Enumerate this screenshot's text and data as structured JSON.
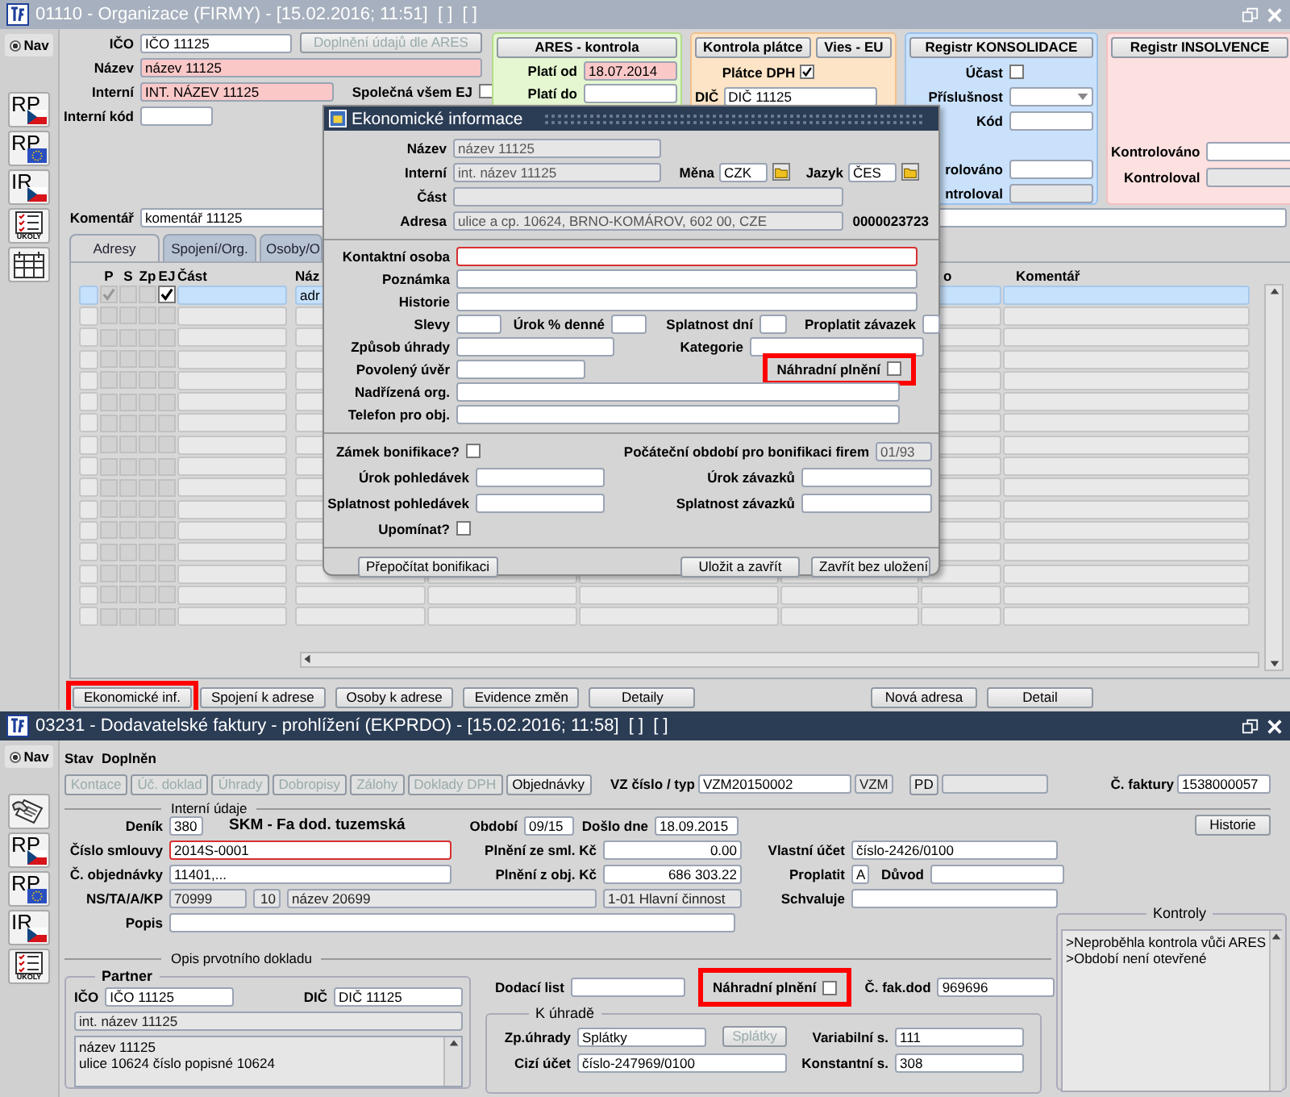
{
  "org_window": {
    "title": "01110 - Organizace (FIRMY) - [15.02.2016; 11:51]  [ ]  [ ]",
    "active": false,
    "nav": {
      "label": "Nav",
      "selected": true
    },
    "tools": [
      {
        "kind": "flag-cz",
        "label": "RP"
      },
      {
        "kind": "flag-eu",
        "label": "RP"
      },
      {
        "kind": "flag-cz",
        "label": "IR"
      },
      {
        "kind": "tasks",
        "label": "ÚKOLY"
      },
      {
        "kind": "calendar"
      }
    ],
    "ico": {
      "label": "IČO",
      "value": "IČO 11125"
    },
    "ares_fill_button": {
      "label": "Doplnění údajů dle ARES",
      "disabled": true
    },
    "nazev": {
      "label": "Název",
      "value": "název 11125",
      "required": true
    },
    "interni": {
      "label": "Interní",
      "value": "INT. NÁZEV 11125",
      "required": true
    },
    "shared": {
      "label": "Společná všem EJ",
      "checked": false
    },
    "interni_kod": {
      "label": "Interní kód"
    },
    "ares_panel": {
      "button": "ARES - kontrola",
      "plati_od": {
        "label": "Platí od",
        "value": "18.07.2014",
        "required": true
      },
      "plati_do": {
        "label": "Platí do"
      }
    },
    "payer_panel": {
      "buttons": [
        "Kontrola plátce",
        "Vies - EU"
      ],
      "platce": {
        "label": "Plátce DPH",
        "checked": true
      },
      "dic": {
        "label": "DIČ",
        "value": "DIČ 11125"
      }
    },
    "consolidation_panel": {
      "button": "Registr KONSOLIDACE",
      "ucast": {
        "label": "Účast",
        "checked": false
      },
      "prislusnost": {
        "label": "Příslušnost"
      },
      "kod": {
        "label": "Kód"
      },
      "kontrolovano": {
        "label": "rolováno",
        "readonly": false
      },
      "kontroloval": {
        "label": "ntroloval",
        "readonly": true
      }
    },
    "insolvency_panel": {
      "button": "Registr INSOLVENCE",
      "kontrolovano": {
        "label": "Kontrolováno",
        "readonly": false
      },
      "kontroloval": {
        "label": "Kontroloval",
        "readonly": true
      }
    },
    "komentar": {
      "label": "Komentář",
      "value": "komentář 11125"
    },
    "tabs": [
      {
        "label": "Adresy",
        "selected": true
      },
      {
        "label": "Spojení/Org.",
        "selected": false
      },
      {
        "label": "Osoby/O",
        "selected": false
      }
    ],
    "table": {
      "columns": [
        "P",
        "S",
        "Zp",
        "EJ",
        "Část",
        "Náz",
        "o",
        "Komentář"
      ],
      "rows": [
        {
          "selected": true,
          "p": true,
          "s": false,
          "zp": false,
          "ej": true,
          "name": "adr"
        },
        {
          "selected": false,
          "p": false,
          "s": false,
          "zp": false,
          "ej": false
        },
        {
          "selected": false,
          "p": false,
          "s": false,
          "zp": false,
          "ej": false
        },
        {
          "selected": false,
          "p": false,
          "s": false,
          "zp": false,
          "ej": false
        },
        {
          "selected": false,
          "p": false,
          "s": false,
          "zp": false,
          "ej": false
        },
        {
          "selected": false,
          "p": false,
          "s": false,
          "zp": false,
          "ej": false
        },
        {
          "selected": false,
          "p": false,
          "s": false,
          "zp": false,
          "ej": false
        },
        {
          "selected": false,
          "p": false,
          "s": false,
          "zp": false,
          "ej": false
        },
        {
          "selected": false,
          "p": false,
          "s": false,
          "zp": false,
          "ej": false
        },
        {
          "selected": false,
          "p": false,
          "s": false,
          "zp": false,
          "ej": false
        },
        {
          "selected": false,
          "p": false,
          "s": false,
          "zp": false,
          "ej": false
        },
        {
          "selected": false,
          "p": false,
          "s": false,
          "zp": false,
          "ej": false
        },
        {
          "selected": false,
          "p": false,
          "s": false,
          "zp": false,
          "ej": false
        },
        {
          "selected": false,
          "p": false,
          "s": false,
          "zp": false,
          "ej": false
        },
        {
          "selected": false,
          "p": false,
          "s": false,
          "zp": false,
          "ej": false
        },
        {
          "selected": false,
          "p": false,
          "s": false,
          "zp": false,
          "ej": false
        }
      ]
    },
    "buttons": [
      {
        "label": "Ekonomické inf.",
        "highlighted": true
      },
      {
        "label": "Spojení k adrese",
        "highlighted": false
      },
      {
        "label": "Osoby k adrese",
        "highlighted": false
      },
      {
        "label": "Evidence změn",
        "highlighted": false
      },
      {
        "label": "Detaily",
        "highlighted": false
      }
    ],
    "right_buttons": [
      {
        "label": "Nová adresa",
        "highlighted": false
      },
      {
        "label": "Detail",
        "highlighted": false
      }
    ]
  },
  "dialog": {
    "title": "Ekonomické informace",
    "nazev": {
      "label": "Název",
      "value": "název 11125",
      "readonly": true
    },
    "interni": {
      "label": "Interní",
      "value": "int. název 11125",
      "readonly": true
    },
    "mena": {
      "label": "Měna",
      "value": "CZK"
    },
    "jazyk": {
      "label": "Jazyk",
      "value": "ČES"
    },
    "cast": {
      "label": "Část",
      "readonly": true
    },
    "adresa": {
      "label": "Adresa",
      "value": "ulice a cp. 10624, BRNO-KOMÁROV, 602 00, CZE",
      "readonly": true
    },
    "record_number": "0000023723",
    "kontaktni_osoba": {
      "label": "Kontaktní osoba",
      "focused": true
    },
    "poznamka": {
      "label": "Poznámka"
    },
    "historie": {
      "label": "Historie"
    },
    "slevy": {
      "label": "Slevy"
    },
    "urok_denne": {
      "label": "Úrok % denné"
    },
    "splatnost_dni": {
      "label": "Splatnost dní"
    },
    "proplatit": {
      "label": "Proplatit závazek"
    },
    "zpusob_uhrady": {
      "label": "Způsob úhrady"
    },
    "kategorie": {
      "label": "Kategorie"
    },
    "povoleny_uver": {
      "label": "Povolený úvěr"
    },
    "nahradni_plneni": {
      "label": "Náhradní plnění",
      "checked": false,
      "highlighted": true
    },
    "nadrizena_org": {
      "label": "Nadřízená org."
    },
    "telefon": {
      "label": "Telefon pro obj."
    },
    "zamek": {
      "label": "Zámek bonifikace?",
      "checked": false
    },
    "pocatecni_obdobi": {
      "label": "Počáteční období pro bonifikaci firem",
      "value": "01/93",
      "readonly": true
    },
    "urok_pohledavek": {
      "label": "Úrok pohledávek"
    },
    "urok_zavazku": {
      "label": "Úrok závazků"
    },
    "splatnost_pohledavek": {
      "label": "Splatnost pohledávek"
    },
    "splatnost_zavazku": {
      "label": "Splatnost závazků"
    },
    "upominat": {
      "label": "Upomínat?",
      "checked": false
    },
    "buttons": [
      "Přepočítat bonifikaci",
      "Uložit a zavřít",
      "Zavřít bez uložení"
    ]
  },
  "invoice_window": {
    "title": "03231 - Dodavatelské faktury - prohlížení (EKPRDO) - [15.02.2016; 11:58]  [ ]  [ ]",
    "active": true,
    "nav": {
      "label": "Nav",
      "selected": true
    },
    "tools": [
      {
        "kind": "hand"
      },
      {
        "kind": "flag-cz",
        "label": "RP"
      },
      {
        "kind": "flag-eu",
        "label": "RP"
      },
      {
        "kind": "flag-cz",
        "label": "IR"
      },
      {
        "kind": "tasks",
        "label": "ÚKOLY"
      }
    ],
    "stav": {
      "label": "Stav",
      "value": "Doplněn"
    },
    "buttons": [
      {
        "label": "Kontace",
        "disabled": true
      },
      {
        "label": "Úč. doklad",
        "disabled": true
      },
      {
        "label": "Úhrady",
        "disabled": true
      },
      {
        "label": "Dobropisy",
        "disabled": true
      },
      {
        "label": "Zálohy",
        "disabled": true
      },
      {
        "label": "Doklady DPH",
        "disabled": true
      },
      {
        "label": "Objednávky",
        "disabled": false
      }
    ],
    "vz": {
      "label": "VZ číslo / typ",
      "value": "VZM20150002",
      "type": "VZM"
    },
    "pd_button": {
      "label": "PD",
      "disabled": false
    },
    "cislo_faktury": {
      "label": "Č. faktury",
      "value": "1538000057"
    },
    "internal_section": "Interní údaje",
    "denik": {
      "label": "Deník",
      "value": "380",
      "name": "SKM - Fa dod. tuzemská"
    },
    "obdobi": {
      "label": "Období",
      "value": "09/15"
    },
    "doslo": {
      "label": "Došlo dne",
      "value": "18.09.2015"
    },
    "historie_button": {
      "label": "Historie",
      "disabled": false
    },
    "cislo_smlouvy": {
      "label": "Číslo smlouvy",
      "value": "2014S-0001",
      "focused": true
    },
    "plneni_sml": {
      "label": "Plnění ze sml. Kč",
      "value": "0.00"
    },
    "vlastni_ucet": {
      "label": "Vlastní účet",
      "value": "číslo-2426/0100"
    },
    "c_objednavky": {
      "label": "Č. objednávky",
      "value": "11401,..."
    },
    "plneni_obj": {
      "label": "Plnění z obj. Kč",
      "value": "686 303.22"
    },
    "proplatit": {
      "label": "Proplatit",
      "value": "A"
    },
    "duvod": {
      "label": "Důvod"
    },
    "ns": {
      "label": "NS/TA/A/KP",
      "values": [
        "70999",
        "10",
        "název 20699",
        "1-01 Hlavní činnost"
      ]
    },
    "schvaluje": {
      "label": "Schvaluje"
    },
    "popis": {
      "label": "Popis"
    },
    "kontroly": {
      "title": "Kontroly",
      "messages": [
        ">Neproběhla kontrola vůči ARES",
        ">Období není otevřené"
      ]
    },
    "opis_section": "Opis prvotního dokladu",
    "partner": {
      "title": "Partner",
      "ico": {
        "label": "IČO",
        "value": "IČO 11125"
      },
      "dic": {
        "label": "DIČ",
        "value": "DIČ 11125"
      },
      "internal_name": "int. název 11125",
      "address_lines": [
        "název 11125",
        "ulice 10624 číslo popisné 10624"
      ]
    },
    "dodaci_list": {
      "label": "Dodací list"
    },
    "nahradni_plneni": {
      "label": "Náhradní plnění",
      "checked": false,
      "highlighted": true
    },
    "c_fak_dod": {
      "label": "Č. fak.dod",
      "value": "969696"
    },
    "k_uhrade": {
      "title": "K úhradě",
      "zp_uhrady": {
        "label": "Zp.úhrady",
        "value": "Splátky"
      },
      "splatky_button": {
        "label": "Splátky",
        "disabled": true
      },
      "variabilni": {
        "label": "Variabilní s.",
        "value": "111"
      },
      "cizi_ucet": {
        "label": "Cizí účet",
        "value": "číslo-247969/0100"
      },
      "konstantni": {
        "label": "Konstantní s.",
        "value": "308"
      }
    }
  }
}
